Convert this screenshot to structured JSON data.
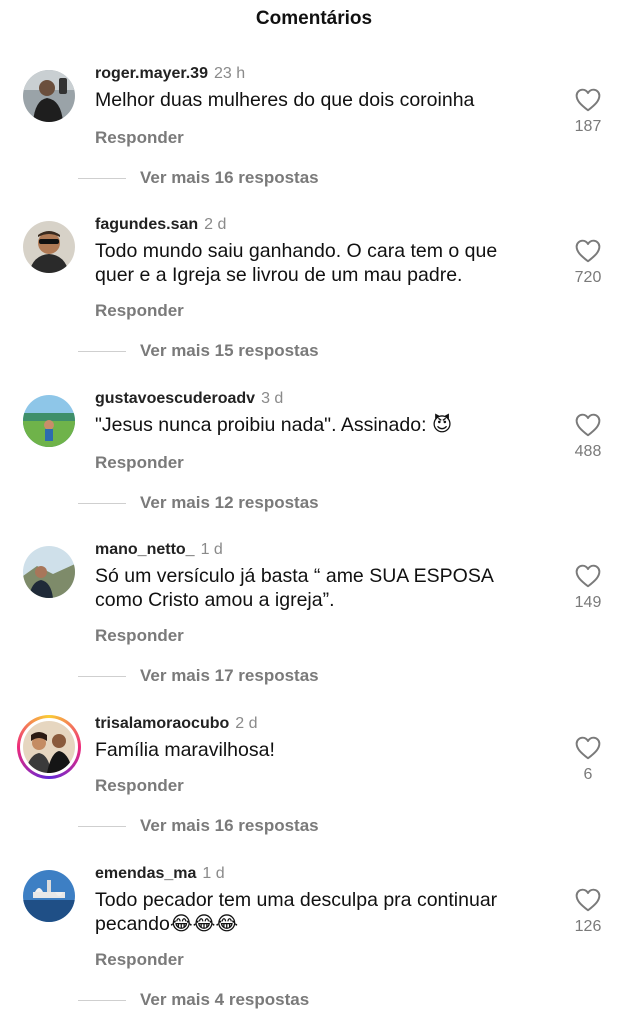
{
  "header": {
    "title": "Comentários"
  },
  "comments": [
    {
      "username": "roger.mayer.39",
      "time": "23 h",
      "text_lines": [
        "Melhor duas mulheres do que dois coroinha"
      ],
      "reply_label": "Responder",
      "likes": "187",
      "more_label": "Ver mais 16 respostas"
    },
    {
      "username": "fagundes.san",
      "time": "2 d",
      "text_lines": [
        "Todo mundo saiu ganhando. O cara tem o que",
        "quer e a Igreja se livrou de um mau padre."
      ],
      "reply_label": "Responder",
      "likes": "720",
      "more_label": "Ver mais 15 respostas"
    },
    {
      "username": "gustavoescuderoadv",
      "time": "3 d",
      "text_lines": [
        "\"Jesus nunca proibiu nada\". Assinado: 😈"
      ],
      "reply_label": "Responder",
      "likes": "488",
      "more_label": "Ver mais 12 respostas"
    },
    {
      "username": "mano_netto_",
      "time": "1 d",
      "text_lines": [
        "Só um versículo já basta “ ame SUA ESPOSA",
        "como Cristo amou a igreja”."
      ],
      "reply_label": "Responder",
      "likes": "149",
      "more_label": "Ver mais 17 respostas"
    },
    {
      "username": "trisalamoraocubo",
      "time": "2 d",
      "text_lines": [
        "Família maravilhosa!"
      ],
      "reply_label": "Responder",
      "likes": "6",
      "more_label": "Ver mais 16 respostas"
    },
    {
      "username": "emendas_ma",
      "time": "1 d",
      "text_lines": [
        "Todo pecador tem uma desculpa pra continuar",
        "pecando😂😂😂"
      ],
      "reply_label": "Responder",
      "likes": "126",
      "more_label": "Ver mais 4 respostas"
    }
  ],
  "icons": {
    "like": "heart-outline-icon",
    "avatar": "profile-photo"
  },
  "colors": {
    "text": "#111111",
    "secondary": "#7a7a7a",
    "divider": "#cfcfcf",
    "story_ring": "#ee2a7b"
  }
}
